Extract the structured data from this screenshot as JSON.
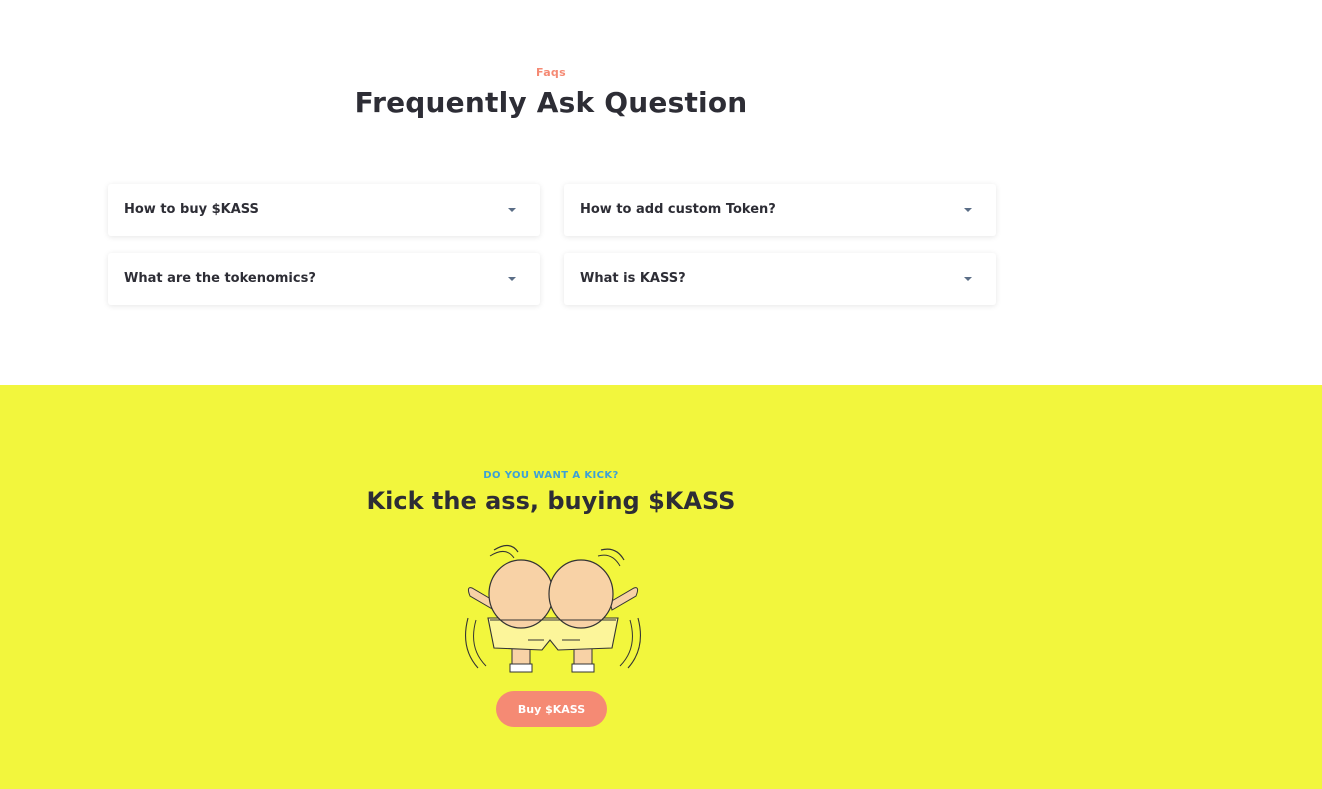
{
  "faq": {
    "kicker": "Faqs",
    "title": "Frequently Ask Question",
    "items": [
      {
        "question": "How to buy $KASS"
      },
      {
        "question": "How to add custom Token?"
      },
      {
        "question": "What are the tokenomics?"
      },
      {
        "question": "What is KASS?"
      }
    ]
  },
  "cta": {
    "kicker": "DO YOU WANT A KICK?",
    "title": "Kick the ass, buying $KASS",
    "button_label": "Buy $KASS"
  },
  "colors": {
    "accent": "#f58a74",
    "cta_background": "#f2f63d",
    "kicker_blue": "#3ca0d6",
    "heading": "#2d2d35",
    "caret": "#5a6d86"
  },
  "icons": {
    "faq_toggle": "caret-down-icon",
    "illustration": "cartoon-butt-illustration"
  }
}
